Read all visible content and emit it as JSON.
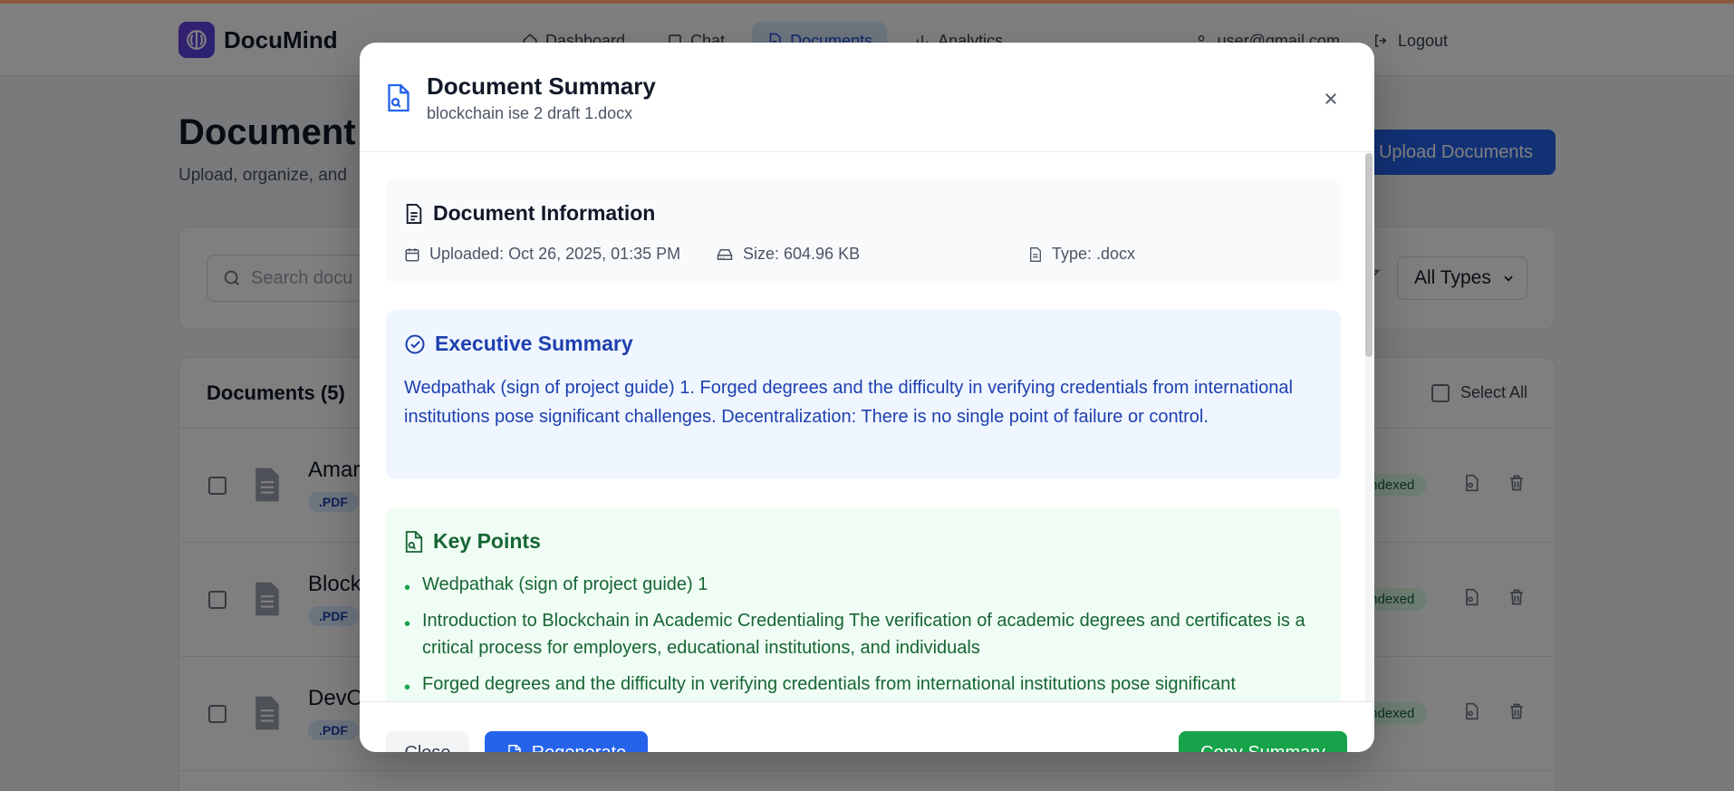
{
  "app": {
    "name": "DocuMind"
  },
  "nav": {
    "links": [
      {
        "label": "Dashboard",
        "icon": "home-icon"
      },
      {
        "label": "Chat",
        "icon": "chat-icon"
      },
      {
        "label": "Documents",
        "icon": "document-icon",
        "active": true
      },
      {
        "label": "Analytics",
        "icon": "bar-chart-icon"
      }
    ],
    "user_email": "user@gmail.com",
    "logout_label": "Logout"
  },
  "page": {
    "title": "Document",
    "subtitle": "Upload, organize, and",
    "upload_label": "Upload Documents"
  },
  "filters": {
    "search_placeholder": "Search docu",
    "type_selected": "All Types"
  },
  "documents": {
    "header": "Documents (5)",
    "select_all_label": "Select All",
    "rows": [
      {
        "name": "Amar",
        "badge": ".PDF",
        "status": "Indexed"
      },
      {
        "name": "Block",
        "badge": ".PDF",
        "status": "Indexed"
      },
      {
        "name": "DevO",
        "badge": ".PDF",
        "status": "Indexed"
      }
    ]
  },
  "modal": {
    "title": "Document Summary",
    "filename": "blockchain ise 2 draft 1.docx",
    "info": {
      "title": "Document Information",
      "uploaded": "Uploaded: Oct 26, 2025, 01:35 PM",
      "size": "Size: 604.96 KB",
      "type": "Type: .docx"
    },
    "executive": {
      "title": "Executive Summary",
      "text": "Wedpathak (sign of project guide) 1. Forged degrees and the difficulty in verifying credentials from international institutions pose significant challenges. Decentralization: There is no single point of failure or control."
    },
    "key_points": {
      "title": "Key Points",
      "items": [
        "Wedpathak (sign of project guide) 1",
        "Introduction to Blockchain in Academic Credentialing The verification of academic degrees and certificates is a critical process for employers, educational institutions, and individuals",
        "Forged degrees and the difficulty in verifying credentials from international institutions pose significant"
      ]
    },
    "footer": {
      "close_label": "Close",
      "regenerate_label": "Regenerate",
      "copy_label": "Copy Summary"
    }
  },
  "colors": {
    "primary": "#2563eb",
    "success": "#16a34a",
    "exec_bg": "#eff6ff",
    "key_bg": "#f0fdf4"
  }
}
